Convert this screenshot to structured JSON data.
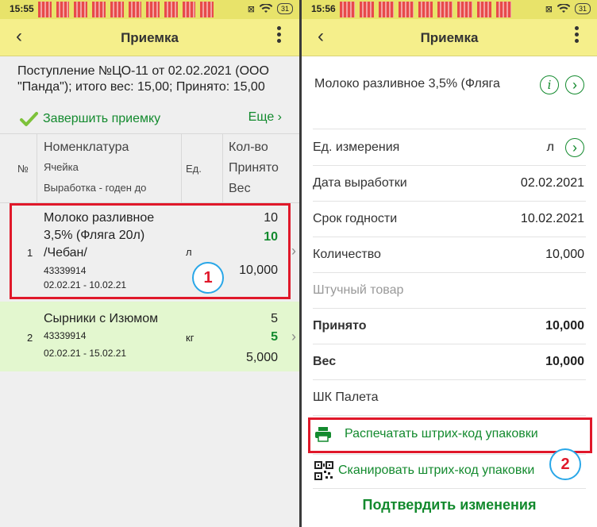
{
  "left": {
    "status": {
      "time": "15:55",
      "battery": "31"
    },
    "header": {
      "title": "Приемка"
    },
    "document_header": "Поступление №ЦО-11 от 02.02.2021 (ООО \"Панда\"); итого вес: 15,00; Принято: 15,00",
    "finish_label": "Завершить приемку",
    "more_label": "Еще",
    "columns": {
      "number": "№",
      "nomenclature": "Номенклатура",
      "cell": "Ячейка",
      "production": "Выработка - годен до",
      "unit": "Ед.",
      "qty": "Кол-во",
      "accepted": "Принято",
      "weight": "Вес"
    },
    "rows": [
      {
        "number": "1",
        "name_l1": "Молоко разливное",
        "name_l2": "3,5% (Фляга 20л)",
        "name_l3": "/Чебан/",
        "code": "43339914",
        "dates": "02.02.21 - 10.02.21",
        "unit": "л",
        "qty": "10",
        "accepted": "10",
        "weight": "10,000"
      },
      {
        "number": "2",
        "name_l1": "Сырники с Изюмом",
        "code": "43339914",
        "dates": "02.02.21 - 15.02.21",
        "unit": "кг",
        "qty": "5",
        "accepted": "5",
        "weight": "5,000"
      }
    ],
    "badge": "1"
  },
  "right": {
    "status": {
      "time": "15:56",
      "battery": "31"
    },
    "header": {
      "title": "Приемка"
    },
    "product_title": "Молоко разливное 3,5% (Фляга",
    "fields": [
      {
        "label": "Ед. измерения",
        "value": "л"
      },
      {
        "label": "Дата выработки",
        "value": "02.02.2021"
      },
      {
        "label": "Срок годности",
        "value": "10.02.2021"
      },
      {
        "label": "Количество",
        "value": "10,000"
      },
      {
        "label": "Штучный товар",
        "value": ""
      },
      {
        "label": "Принято",
        "value": "10,000"
      },
      {
        "label": "Вес",
        "value": "10,000"
      },
      {
        "label": "ШК Палета",
        "value": ""
      }
    ],
    "print_label": "Распечатать штрих-код упаковки",
    "scan_label": "Сканировать штрих-код упаковки",
    "confirm_label": "Подтвердить изменения",
    "badge": "2"
  },
  "colors": {
    "header_bg": "#f5ef8b",
    "accent_green": "#138a2e",
    "highlight_red": "#e0182a",
    "badge_blue": "#29a7e8",
    "selected_row": "#e3f7cf"
  }
}
